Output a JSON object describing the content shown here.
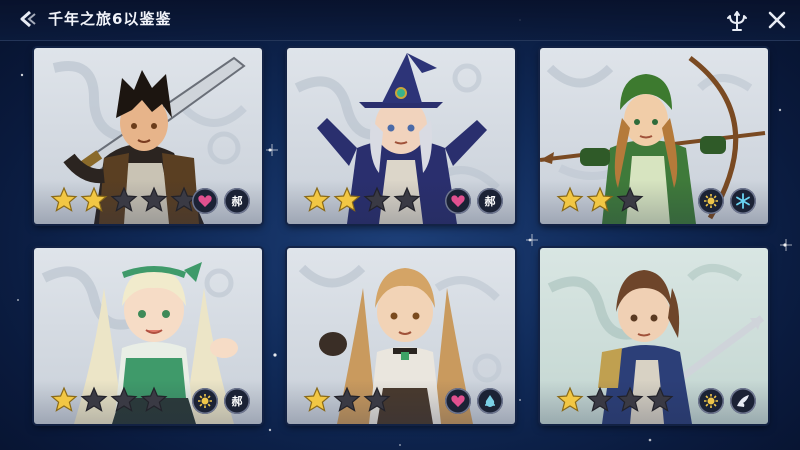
{
  "header": {
    "title": "千年之旅6以鉴鉴"
  },
  "icons": {
    "back": "back-arrow-icon",
    "trident": "trident-icon",
    "close": "close-icon"
  },
  "colors": {
    "background": "#102a58",
    "star_filled": "#f2c744",
    "star_empty": "#3a3a44",
    "heart": "#e0508f",
    "sun": "#f0c64a",
    "snowflake": "#6ad4f2",
    "drop": "#7bd0e6"
  },
  "cards": [
    {
      "character": "dark-haired-swordsman",
      "stars_filled": 2,
      "stars_total": 5,
      "badges": [
        {
          "icon": "heart-icon"
        },
        {
          "icon": "text",
          "text": "郝"
        }
      ]
    },
    {
      "character": "white-haired-witch",
      "stars_filled": 2,
      "stars_total": 4,
      "badges": [
        {
          "icon": "heart-icon"
        },
        {
          "icon": "text",
          "text": "郝"
        }
      ]
    },
    {
      "character": "green-hooded-archer",
      "stars_filled": 2,
      "stars_total": 3,
      "badges": [
        {
          "icon": "sun-icon"
        },
        {
          "icon": "snowflake-icon"
        }
      ]
    },
    {
      "character": "blonde-green-dress-girl",
      "stars_filled": 1,
      "stars_total": 4,
      "badges": [
        {
          "icon": "sun-icon"
        },
        {
          "icon": "text",
          "text": "郝"
        }
      ]
    },
    {
      "character": "blonde-brawler",
      "stars_filled": 1,
      "stars_total": 3,
      "badges": [
        {
          "icon": "heart-icon"
        },
        {
          "icon": "drop-icon"
        }
      ]
    },
    {
      "character": "brown-haired-knight",
      "stars_filled": 1,
      "stars_total": 4,
      "badges": [
        {
          "icon": "sun-icon"
        },
        {
          "icon": "wing-icon"
        }
      ]
    }
  ]
}
